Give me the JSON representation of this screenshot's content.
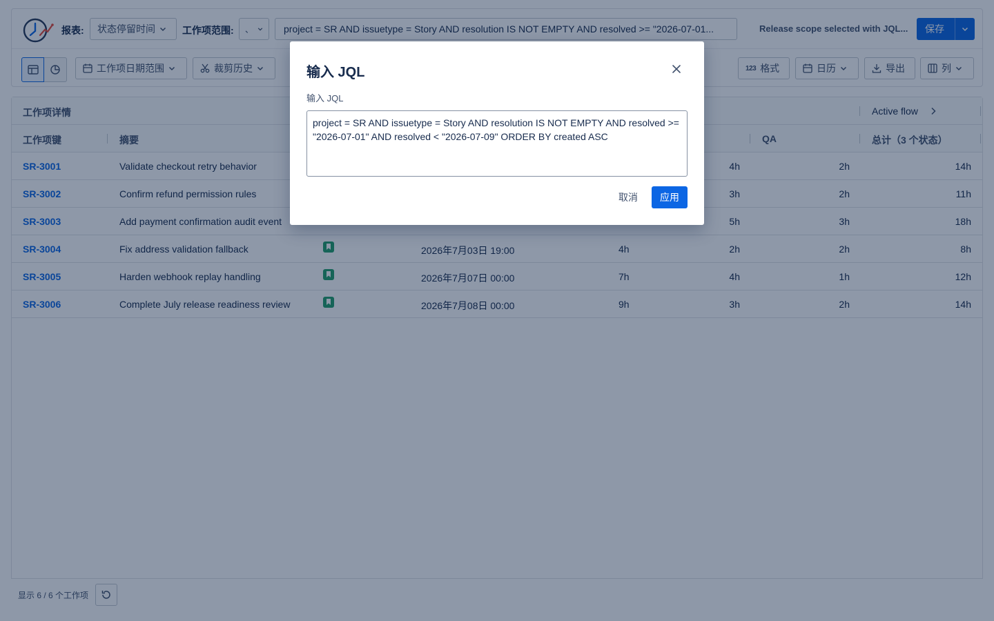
{
  "toolbar": {
    "report_label": "报表:",
    "report_value": "状态停留时间",
    "scope_label": "工作项范围:",
    "scope_value": "、",
    "jql_preview": "project = SR AND issuetype = Story AND resolution IS NOT EMPTY AND resolved >= \"2026-07-01...",
    "status_text": "Release scope selected with JQL...",
    "save_label": "保存",
    "date_range_label": "工作项日期范围",
    "trim_history_label": "裁剪历史",
    "format_label": "格式",
    "format_glyph": "123",
    "calendar_label": "日历",
    "export_label": "导出",
    "columns_label": "列"
  },
  "table": {
    "group_left": "工作项详情",
    "group_right": "Active flow",
    "headers": {
      "key": "工作项键",
      "summary": "摘要",
      "qa": "QA",
      "total": "总计（3 个状态）"
    },
    "rows": [
      {
        "key": "SR-3001",
        "summary": "Validate checkout retry behavior",
        "date": "",
        "d1": "",
        "d2": "4h",
        "qa": "2h",
        "total": "14h",
        "icon": false
      },
      {
        "key": "SR-3002",
        "summary": "Confirm refund permission rules",
        "date": "",
        "d1": "",
        "d2": "3h",
        "qa": "2h",
        "total": "11h",
        "icon": false
      },
      {
        "key": "SR-3003",
        "summary": "Add payment confirmation audit event",
        "date": "",
        "d1": "",
        "d2": "5h",
        "qa": "3h",
        "total": "18h",
        "icon": false
      },
      {
        "key": "SR-3004",
        "summary": "Fix address validation fallback",
        "date": "2026年7月03日 19:00",
        "d1": "4h",
        "d2": "2h",
        "qa": "2h",
        "total": "8h",
        "icon": true
      },
      {
        "key": "SR-3005",
        "summary": "Harden webhook replay handling",
        "date": "2026年7月07日 00:00",
        "d1": "7h",
        "d2": "4h",
        "qa": "1h",
        "total": "12h",
        "icon": true
      },
      {
        "key": "SR-3006",
        "summary": "Complete July release readiness review",
        "date": "2026年7月08日 00:00",
        "d1": "9h",
        "d2": "3h",
        "qa": "2h",
        "total": "14h",
        "icon": true
      }
    ]
  },
  "footer": {
    "count_text": "显示 6 / 6 个工作项"
  },
  "modal": {
    "title": "输入 JQL",
    "field_label": "输入 JQL",
    "jql_value": "project = SR AND issuetype = Story AND resolution IS NOT EMPTY AND resolved >= \"2026-07-01\" AND resolved < \"2026-07-09\" ORDER BY created ASC",
    "cancel_label": "取消",
    "apply_label": "应用"
  },
  "colors": {
    "accent": "#0c66e4",
    "story_icon": "#22a06b",
    "overlay": "#091e42"
  },
  "icons": [
    "report-logo-icon",
    "chevron-down-icon",
    "table-view-icon",
    "chart-view-icon",
    "calendar-icon",
    "scissors-icon",
    "download-icon",
    "columns-icon",
    "chevron-right-icon",
    "refresh-icon",
    "close-icon",
    "story-icon"
  ]
}
